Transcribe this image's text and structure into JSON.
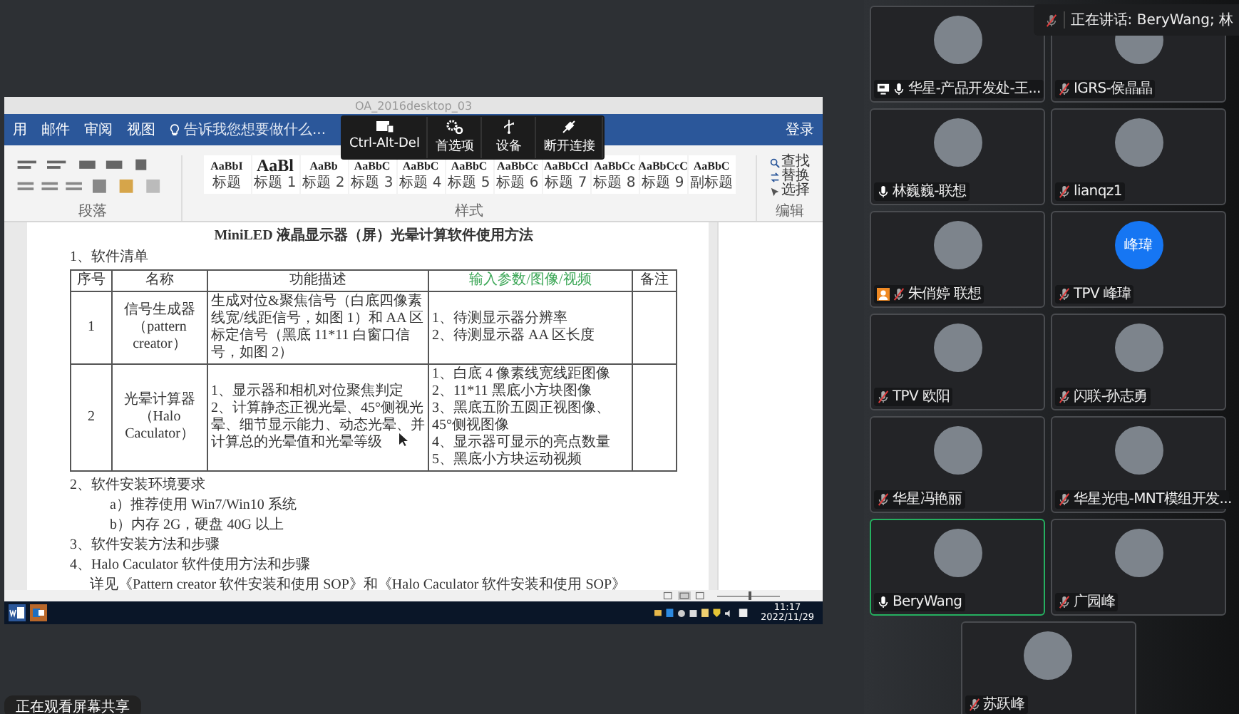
{
  "window": {
    "title": "OA_2016desktop_03"
  },
  "ribbon_tabs": [
    "用",
    "邮件",
    "审阅",
    "视图"
  ],
  "tell_me": {
    "placeholder": "告诉我您想要做什么..."
  },
  "sign_in": "登录",
  "remote_toolbar": [
    {
      "label": "Ctrl-Alt-Del",
      "kind": "keys"
    },
    {
      "label": "首选项",
      "kind": "gears"
    },
    {
      "label": "设备",
      "kind": "usb"
    },
    {
      "label": "断开连接",
      "kind": "plug"
    }
  ],
  "styles": [
    {
      "sample": "AaBbI",
      "label": "标题"
    },
    {
      "sample": "AaBl",
      "label": "标题 1"
    },
    {
      "sample": "AaBb",
      "label": "标题 2"
    },
    {
      "sample": "AaBbC",
      "label": "标题 3"
    },
    {
      "sample": "AaBbC",
      "label": "标题 4"
    },
    {
      "sample": "AaBbC",
      "label": "标题 5"
    },
    {
      "sample": "AaBbCc",
      "label": "标题 6"
    },
    {
      "sample": "AaBbCcl",
      "label": "标题 7"
    },
    {
      "sample": "AaBbCc",
      "label": "标题 8"
    },
    {
      "sample": "AaBbCcC",
      "label": "标题 9"
    },
    {
      "sample": "AaBbC",
      "label": "副标题"
    }
  ],
  "ribbon_groups": [
    "段落",
    "样式",
    "编辑"
  ],
  "edit_commands": [
    {
      "label": "查找",
      "kind": "find"
    },
    {
      "label": "替换",
      "kind": "replace"
    },
    {
      "label": "选择",
      "kind": "select"
    }
  ],
  "document": {
    "title": "MiniLED 液晶显示器（屏）光晕计算软件使用方法",
    "section_1": "1、软件清单",
    "table": {
      "columns": [
        {
          "label": "序号",
          "color": "#333333"
        },
        {
          "label": "名称",
          "color": "#333333"
        },
        {
          "label": "功能描述",
          "color": "#333333"
        },
        {
          "label": "输入参数/图像/视频",
          "color": "#3aa655"
        },
        {
          "label": "备注",
          "color": "#333333"
        }
      ],
      "rows": [
        [
          [
            "1"
          ],
          [
            "信号生成器",
            "（pattern creator）"
          ],
          [
            "生成对位&聚焦信号（白底四像素线宽/线距信号，如图 1）和 AA 区标定信号（黑底 11*11 白窗口信号，如图 2）"
          ],
          [
            "1、待测显示器分辨率",
            "2、待测显示器 AA 区长度"
          ],
          []
        ],
        [
          [
            "2"
          ],
          [
            "光晕计算器",
            "（Halo Caculator）"
          ],
          [
            "1、显示器和相机对位聚焦判定",
            "2、计算静态正视光晕、45°侧视光晕、细节显示能力、动态光晕、并计算总的光晕值和光晕等级"
          ],
          [
            "1、白底 4 像素线宽线距图像",
            "2、11*11 黑底小方块图像",
            "3、黑底五阶五圆正视图像、45°侧视图像",
            "4、显示器可显示的亮点数量",
            "5、黑底小方块运动视频"
          ],
          []
        ]
      ]
    },
    "items": [
      {
        "text": "2、软件安装环境要求",
        "children": [
          {
            "text": "a）推荐使用 Win7/Win10 系统"
          },
          {
            "text": "b）内存 2G，硬盘 40G 以上"
          }
        ]
      },
      {
        "text": "3、软件安装方法和步骤"
      },
      {
        "text": "4、Halo Caculator 软件使用方法和步骤",
        "children": [
          {
            "text": "详见《Pattern creator 软件安装和使用 SOP》和《Halo Caculator 软件安装和使用 SOP》"
          }
        ]
      }
    ]
  },
  "status_bar": {
    "zoom": {
      "level": 0.5
    }
  },
  "taskbar": {
    "time": "11:17",
    "date": "2022/11/29"
  },
  "viewer_notice": "正在观看屏幕共享",
  "speaking_banner": "正在讲话: BeryWang; 林",
  "participants": [
    {
      "name": "华星-产品开发处-王...",
      "muted": false,
      "selected": false,
      "avatar": {
        "kind": "photo"
      },
      "badge": {
        "kind": "screen"
      }
    },
    {
      "name": "IGRS-侯晶晶",
      "muted": true,
      "selected": false,
      "avatar": {
        "kind": "photo"
      }
    },
    {
      "name": "林巍巍-联想",
      "muted": false,
      "selected": false,
      "avatar": {
        "kind": "photo"
      }
    },
    {
      "name": "lianqz1",
      "muted": true,
      "selected": false,
      "avatar": {
        "kind": "photo"
      }
    },
    {
      "name": "朱俏婷 联想",
      "muted": true,
      "selected": false,
      "avatar": {
        "kind": "photo"
      },
      "badge": {
        "kind": "person"
      }
    },
    {
      "name": "TPV 峰瑋",
      "muted": true,
      "selected": false,
      "avatar": {
        "kind": "initials",
        "initials": "峰瑋"
      }
    },
    {
      "name": "TPV 欧阳",
      "muted": true,
      "selected": false,
      "avatar": {
        "kind": "photo"
      }
    },
    {
      "name": "闪联-孙志勇",
      "muted": true,
      "selected": false,
      "avatar": {
        "kind": "photo"
      }
    },
    {
      "name": "华星冯艳丽",
      "muted": true,
      "selected": false,
      "avatar": {
        "kind": "photo"
      }
    },
    {
      "name": "华星光电-MNT模组开发...",
      "muted": true,
      "selected": false,
      "avatar": {
        "kind": "photo"
      }
    },
    {
      "name": "BeryWang",
      "muted": false,
      "selected": true,
      "avatar": {
        "kind": "photo"
      }
    },
    {
      "name": "广园峰",
      "muted": true,
      "selected": false,
      "avatar": {
        "kind": "photo"
      }
    },
    {
      "name": "苏跃峰",
      "muted": true,
      "selected": false,
      "avatar": {
        "kind": "photo"
      }
    }
  ]
}
